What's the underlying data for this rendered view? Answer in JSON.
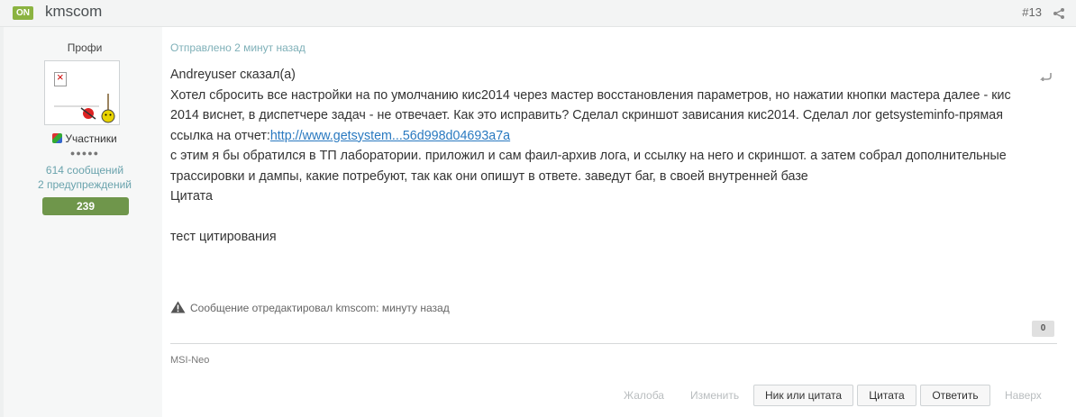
{
  "header": {
    "online_label": "ON",
    "author": "kmscom",
    "post_number": "#13"
  },
  "user": {
    "title": "Профи",
    "group": "Участники",
    "rank_dots": "●●●●●",
    "messages": "614 сообщений",
    "warnings": "2 предупреждений",
    "reputation": "239"
  },
  "post": {
    "posted": "Отправлено 2 минут назад",
    "quote_header": "Andreyuser сказал(а)",
    "line1": "Хотел сбросить все настройки на по умолчанию кис2014 через мастер восстановления параметров, но нажатии кнопки мастера далее - кис 2014 виснет, в диспетчере задач - не отвечает. Как это исправить? Сделал скриншот зависания кис2014. Сделал лог getsysteminfo-прямая ссылка на отчет:",
    "link": "http://www.getsystem...56d998d04693a7a",
    "line2": "с этим я бы обратился в ТП лаборатории. приложил и сам фаил-архив лога, и ссылку на него и скриншот. а затем собрал дополнительные трассировки и дампы, какие потребуют, так как они опишут в ответе. заведут баг, в своей внутренней базе",
    "quote_label": "Цитата",
    "reply_text": "тест цитирования",
    "edit_note": "Сообщение отредактировал kmscom: минуту назад",
    "reaction_count": "0",
    "signature": "MSI-Neo"
  },
  "actions": {
    "report": "Жалоба",
    "edit": "Изменить",
    "nick_quote": "Ник или цитата",
    "quote": "Цитата",
    "reply": "Ответить",
    "top": "Наверх"
  },
  "colors": {
    "online": "#8bb341",
    "reputation": "#6f964b",
    "link": "#2979c0",
    "meta": "#7fb0b8"
  },
  "icons": [
    "share-icon",
    "broken-image-icon",
    "group-icon",
    "quote-arrow-icon",
    "warning-icon"
  ]
}
